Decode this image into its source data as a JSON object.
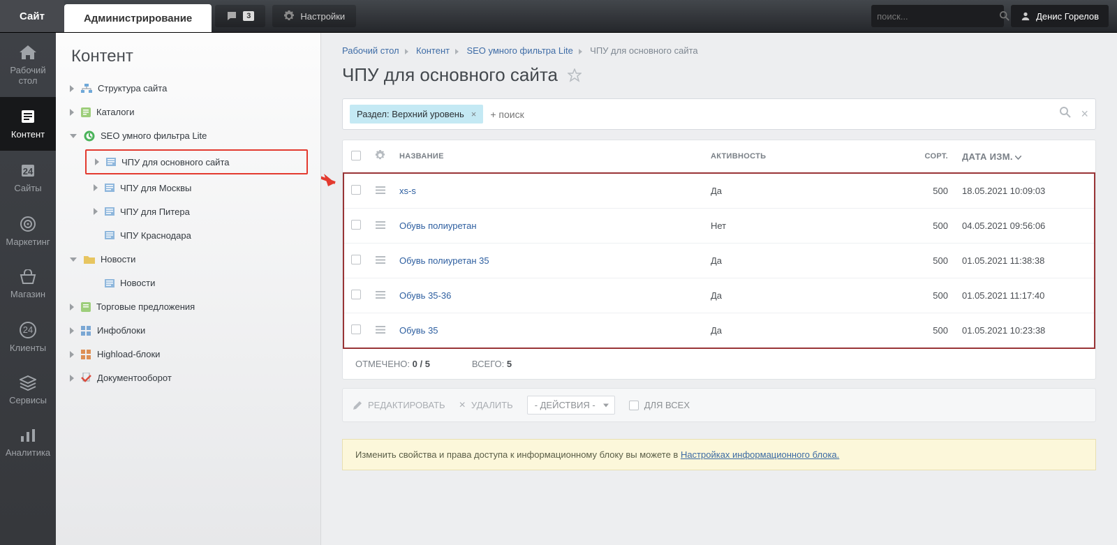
{
  "topbar": {
    "site_tab": "Сайт",
    "admin_tab": "Администрирование",
    "notif_count": "3",
    "settings_label": "Настройки",
    "search_placeholder": "поиск...",
    "user_name": "Денис Горелов"
  },
  "iconbar": [
    {
      "name": "desktop",
      "label": "Рабочий стол"
    },
    {
      "name": "content",
      "label": "Контент"
    },
    {
      "name": "sites",
      "label": "Сайты"
    },
    {
      "name": "marketing",
      "label": "Маркетинг"
    },
    {
      "name": "shop",
      "label": "Магазин"
    },
    {
      "name": "clients",
      "label": "Клиенты"
    },
    {
      "name": "services",
      "label": "Сервисы"
    },
    {
      "name": "analytics",
      "label": "Аналитика"
    }
  ],
  "side_title": "Контент",
  "tree": {
    "struct": "Структура сайта",
    "catalogs": "Каталоги",
    "seo": "SEO умного фильтра Lite",
    "seo_children": [
      "ЧПУ для основного сайта",
      "ЧПУ для Москвы",
      "ЧПУ для Питера",
      "ЧПУ Краснодара"
    ],
    "news": "Новости",
    "news_child": "Новости",
    "trade": "Торговые предложения",
    "infoblocks": "Инфоблоки",
    "highload": "Highload-блоки",
    "docflow": "Документооборот"
  },
  "breadcrumbs": [
    "Рабочий стол",
    "Контент",
    "SEO умного фильтра Lite",
    "ЧПУ для основного сайта"
  ],
  "page_title": "ЧПУ для основного сайта",
  "filter_tag": "Раздел: Верхний уровень",
  "filter_placeholder": "+ поиск",
  "columns": {
    "name": "НАЗВАНИЕ",
    "active": "АКТИВНОСТЬ",
    "sort": "СОРТ.",
    "date": "ДАТА ИЗМ."
  },
  "rows": [
    {
      "name": "xs-s",
      "active": "Да",
      "sort": "500",
      "date": "18.05.2021 10:09:03"
    },
    {
      "name": "Обувь полиуретан",
      "active": "Нет",
      "sort": "500",
      "date": "04.05.2021 09:56:06"
    },
    {
      "name": "Обувь полиуретан 35",
      "active": "Да",
      "sort": "500",
      "date": "01.05.2021 11:38:38"
    },
    {
      "name": "Обувь 35-36",
      "active": "Да",
      "sort": "500",
      "date": "01.05.2021 11:17:40"
    },
    {
      "name": "Обувь 35",
      "active": "Да",
      "sort": "500",
      "date": "01.05.2021 10:23:38"
    }
  ],
  "footer": {
    "checked_label": "ОТМЕЧЕНО:",
    "checked_val": "0 / 5",
    "total_label": "ВСЕГО:",
    "total_val": "5"
  },
  "actions": {
    "edit": "РЕДАКТИРОВАТЬ",
    "delete": "УДАЛИТЬ",
    "dropdown": "- ДЕЙСТВИЯ -",
    "forall": "ДЛЯ ВСЕХ"
  },
  "hint_text": "Изменить свойства и права доступа к информационному блоку вы можете в ",
  "hint_link": "Настройках информационного блока."
}
